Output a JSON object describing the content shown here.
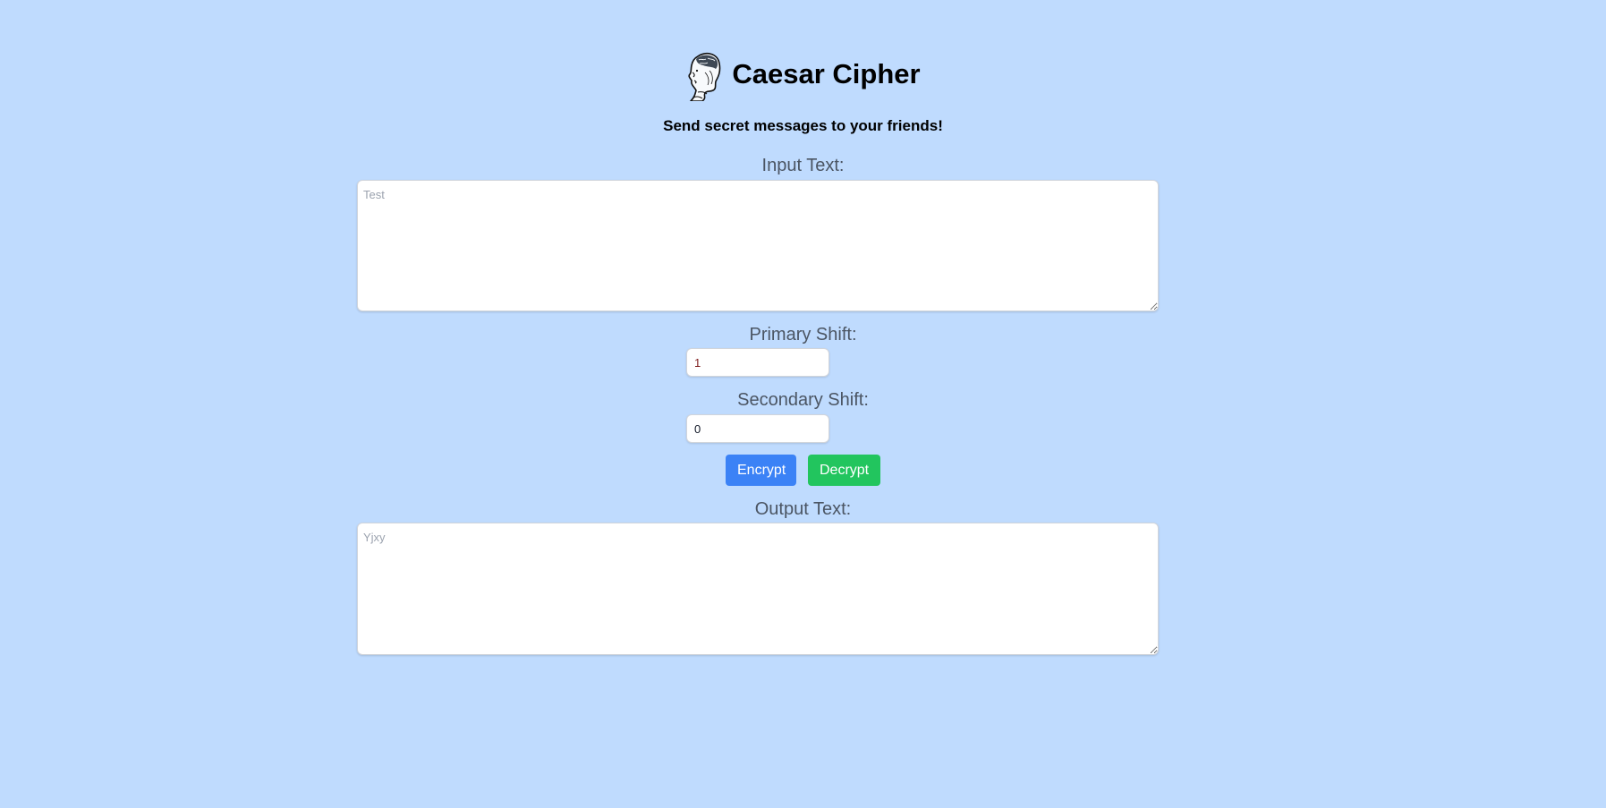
{
  "app": {
    "title": "Caesar Cipher",
    "tagline": "Send secret messages to your friends!"
  },
  "input": {
    "label": "Input Text:",
    "placeholder": "Test",
    "value": ""
  },
  "primary_shift": {
    "label": "Primary Shift:",
    "value": "1"
  },
  "secondary_shift": {
    "label": "Secondary Shift:",
    "value": "0"
  },
  "buttons": {
    "encrypt": "Encrypt",
    "decrypt": "Decrypt"
  },
  "output": {
    "label": "Output Text:",
    "placeholder": "Yjxy",
    "value": ""
  },
  "colors": {
    "background": "#bfdbfe",
    "encrypt": "#3b82f6",
    "decrypt": "#22c55e"
  },
  "icons": {
    "logo": "caesar-head-icon"
  }
}
